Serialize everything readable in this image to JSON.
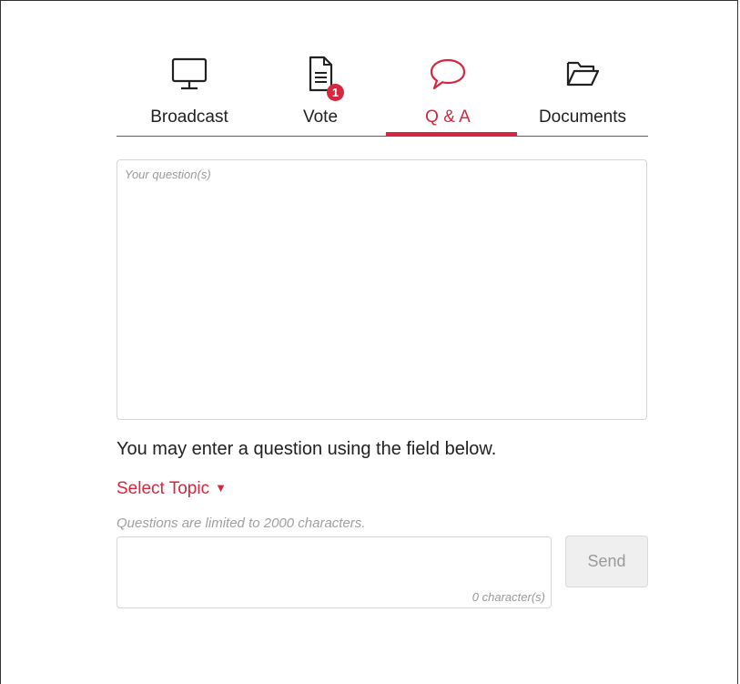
{
  "tabs": [
    {
      "label": "Broadcast",
      "icon": "monitor-icon"
    },
    {
      "label": "Vote",
      "icon": "document-icon",
      "badge": "1"
    },
    {
      "label": "Q & A",
      "icon": "speech-bubble-icon",
      "active": true
    },
    {
      "label": "Documents",
      "icon": "folder-icon"
    }
  ],
  "question_box": {
    "placeholder": "Your question(s)"
  },
  "info_text": "You may enter a question using the field below.",
  "select_topic": {
    "label": "Select Topic",
    "icon": "caret-down-icon"
  },
  "limit_text": "Questions are limited to 2000  characters.",
  "input": {
    "counter": "0 character(s)"
  },
  "send_button": {
    "label": "Send"
  },
  "colors": {
    "accent": "#d7263d",
    "border": "#d6d6d6",
    "muted": "#9a9a9a",
    "button_bg": "#efefef"
  }
}
